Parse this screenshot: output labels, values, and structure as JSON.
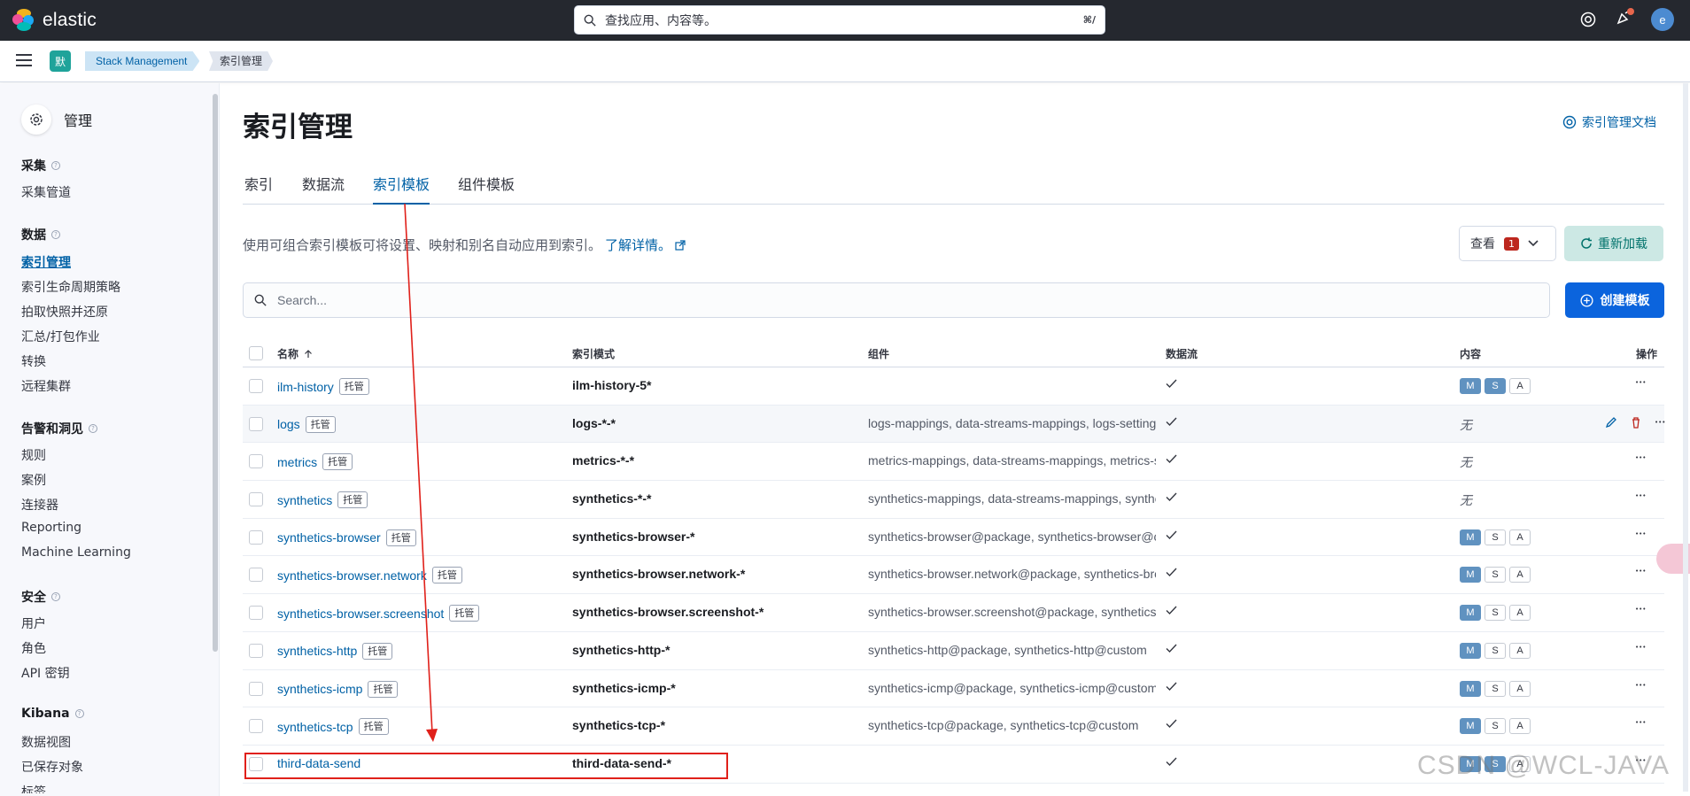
{
  "app": {
    "name": "elastic"
  },
  "top_search": {
    "placeholder": "查找应用、内容等。",
    "shortcut": "⌘/"
  },
  "header_icons": [
    "help-icon",
    "newsfeed-icon",
    "user-avatar"
  ],
  "user": {
    "initial": "e"
  },
  "space": {
    "initial": "默"
  },
  "breadcrumbs": [
    {
      "label": "Stack Management"
    },
    {
      "label": "索引管理"
    }
  ],
  "sidebar": {
    "title": "管理",
    "sections": [
      {
        "title": "采集",
        "items": [
          "采集管道"
        ]
      },
      {
        "title": "数据",
        "items": [
          "索引管理",
          "索引生命周期策略",
          "拍取快照并还原",
          "汇总/打包作业",
          "转换",
          "远程集群"
        ]
      },
      {
        "title": "告警和洞见",
        "items": [
          "规则",
          "案例",
          "连接器",
          "Reporting",
          "Machine Learning"
        ]
      },
      {
        "title": "安全",
        "items": [
          "用户",
          "角色",
          "API 密钥"
        ]
      },
      {
        "title": "Kibana",
        "items": [
          "数据视图",
          "已保存对象",
          "标签"
        ]
      }
    ],
    "active_item": "索引管理"
  },
  "page": {
    "title": "索引管理",
    "docs_link": "索引管理文档",
    "tabs": [
      "索引",
      "数据流",
      "索引模板",
      "组件模板"
    ],
    "active_tab": "索引模板",
    "description": "使用可组合索引模板可将设置、映射和别名自动应用到索引。",
    "learn_more": "了解详情。",
    "view_button": "查看",
    "view_count": "1",
    "reload_button": "重新加载",
    "search_placeholder": "Search...",
    "create_button": "创建模板"
  },
  "table": {
    "columns": [
      "名称",
      "索引模式",
      "组件",
      "数据流",
      "内容",
      "操作"
    ],
    "managed_tag": "托管",
    "none_text": "无",
    "rows": [
      {
        "name": "ilm-history",
        "managed": true,
        "pattern": "ilm-history-5*",
        "components": "",
        "data_stream": true,
        "content": [
          "M",
          "S",
          "A"
        ],
        "content_on": [
          true,
          true,
          false
        ]
      },
      {
        "name": "logs",
        "managed": true,
        "pattern": "logs-*-*",
        "components": "logs-mappings, data-streams-mappings, logs-settings",
        "data_stream": true,
        "content": null
      },
      {
        "name": "metrics",
        "managed": true,
        "pattern": "metrics-*-*",
        "components": "metrics-mappings, data-streams-mappings, metrics-settings",
        "data_stream": true,
        "content": null
      },
      {
        "name": "synthetics",
        "managed": true,
        "pattern": "synthetics-*-*",
        "components": "synthetics-mappings, data-streams-mappings, synthetics-settings",
        "data_stream": true,
        "content": null
      },
      {
        "name": "synthetics-browser",
        "managed": true,
        "pattern": "synthetics-browser-*",
        "components": "synthetics-browser@package, synthetics-browser@custom",
        "data_stream": true,
        "content": [
          "M",
          "S",
          "A"
        ],
        "content_on": [
          true,
          false,
          false
        ]
      },
      {
        "name": "synthetics-browser.network",
        "managed": true,
        "pattern": "synthetics-browser.network-*",
        "components": "synthetics-browser.network@package, synthetics-browser.network@custom",
        "data_stream": true,
        "content": [
          "M",
          "S",
          "A"
        ],
        "content_on": [
          true,
          false,
          false
        ]
      },
      {
        "name": "synthetics-browser.screenshot",
        "managed": true,
        "pattern": "synthetics-browser.screenshot-*",
        "components": "synthetics-browser.screenshot@package, synthetics-browser.screenshot@custom",
        "data_stream": true,
        "content": [
          "M",
          "S",
          "A"
        ],
        "content_on": [
          true,
          false,
          false
        ]
      },
      {
        "name": "synthetics-http",
        "managed": true,
        "pattern": "synthetics-http-*",
        "components": "synthetics-http@package, synthetics-http@custom",
        "data_stream": true,
        "content": [
          "M",
          "S",
          "A"
        ],
        "content_on": [
          true,
          false,
          false
        ]
      },
      {
        "name": "synthetics-icmp",
        "managed": true,
        "pattern": "synthetics-icmp-*",
        "components": "synthetics-icmp@package, synthetics-icmp@custom",
        "data_stream": true,
        "content": [
          "M",
          "S",
          "A"
        ],
        "content_on": [
          true,
          false,
          false
        ]
      },
      {
        "name": "synthetics-tcp",
        "managed": true,
        "pattern": "synthetics-tcp-*",
        "components": "synthetics-tcp@package, synthetics-tcp@custom",
        "data_stream": true,
        "content": [
          "M",
          "S",
          "A"
        ],
        "content_on": [
          true,
          false,
          false
        ]
      },
      {
        "name": "third-data-send",
        "managed": false,
        "pattern": "third-data-send-*",
        "components": "",
        "data_stream": true,
        "content": [
          "M",
          "S",
          "A"
        ],
        "content_on": [
          true,
          true,
          false
        ]
      }
    ]
  },
  "watermark": "CSDN @WCL-JAVA",
  "colors": {
    "header_bg": "#25282f",
    "link": "#0061a6",
    "primary": "#0b64dd",
    "annotation": "#e0201a"
  }
}
